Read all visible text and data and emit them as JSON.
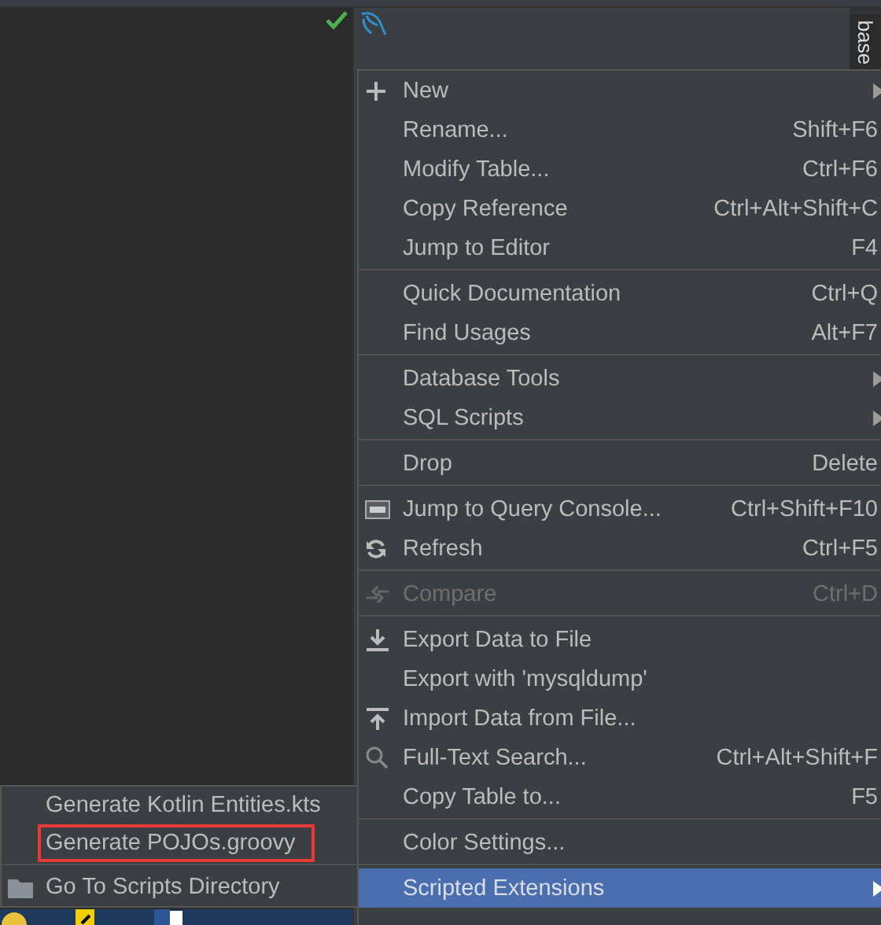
{
  "side_tab": {
    "label": "base"
  },
  "context_menu": {
    "groups": [
      {
        "items": [
          {
            "label": "New",
            "submenu": true,
            "disabled": false,
            "selected": false
          },
          {
            "label": "Rename...",
            "shortcut": "Shift+F6",
            "submenu": false,
            "disabled": false,
            "selected": false
          },
          {
            "label": "Modify Table...",
            "shortcut": "Ctrl+F6",
            "submenu": false,
            "disabled": false,
            "selected": false
          },
          {
            "label": "Copy Reference",
            "shortcut": "Ctrl+Alt+Shift+C",
            "submenu": false,
            "disabled": false,
            "selected": false
          },
          {
            "label": "Jump to Editor",
            "shortcut": "F4",
            "submenu": false,
            "disabled": false,
            "selected": false
          }
        ]
      },
      {
        "items": [
          {
            "label": "Quick Documentation",
            "shortcut": "Ctrl+Q",
            "submenu": false,
            "disabled": false,
            "selected": false
          },
          {
            "label": "Find Usages",
            "shortcut": "Alt+F7",
            "submenu": false,
            "disabled": false,
            "selected": false
          }
        ]
      },
      {
        "items": [
          {
            "label": "Database Tools",
            "submenu": true,
            "disabled": false,
            "selected": false
          },
          {
            "label": "SQL Scripts",
            "submenu": true,
            "disabled": false,
            "selected": false
          }
        ]
      },
      {
        "items": [
          {
            "label": "Drop",
            "shortcut": "Delete",
            "submenu": false,
            "disabled": false,
            "selected": false
          }
        ]
      },
      {
        "items": [
          {
            "label": "Jump to Query Console...",
            "shortcut": "Ctrl+Shift+F10",
            "submenu": false,
            "disabled": false,
            "selected": false
          },
          {
            "label": "Refresh",
            "shortcut": "Ctrl+F5",
            "submenu": false,
            "disabled": false,
            "selected": false
          }
        ]
      },
      {
        "items": [
          {
            "label": "Compare",
            "shortcut": "Ctrl+D",
            "submenu": false,
            "disabled": true,
            "selected": false
          }
        ]
      },
      {
        "items": [
          {
            "label": "Export Data to File",
            "submenu": false,
            "disabled": false,
            "selected": false
          },
          {
            "label": "Export with 'mysqldump'",
            "submenu": false,
            "disabled": false,
            "selected": false
          },
          {
            "label": "Import Data from File...",
            "submenu": false,
            "disabled": false,
            "selected": false
          },
          {
            "label": "Full-Text Search...",
            "shortcut": "Ctrl+Alt+Shift+F",
            "submenu": false,
            "disabled": false,
            "selected": false
          },
          {
            "label": "Copy Table to...",
            "shortcut": "F5",
            "submenu": false,
            "disabled": false,
            "selected": false
          }
        ]
      },
      {
        "items": [
          {
            "label": "Color Settings...",
            "submenu": false,
            "disabled": false,
            "selected": false
          }
        ]
      },
      {
        "items": [
          {
            "label": "Scripted Extensions",
            "submenu": true,
            "disabled": false,
            "selected": true
          }
        ]
      }
    ]
  },
  "submenu": {
    "groups": [
      {
        "items": [
          {
            "label": "Generate Kotlin Entities.kts",
            "selected": false,
            "outlined": false
          },
          {
            "label": "Generate POJOs.groovy",
            "selected": false,
            "outlined": true
          }
        ]
      },
      {
        "items": [
          {
            "label": "Go To Scripts Directory",
            "selected": false,
            "outlined": false
          }
        ]
      }
    ]
  }
}
